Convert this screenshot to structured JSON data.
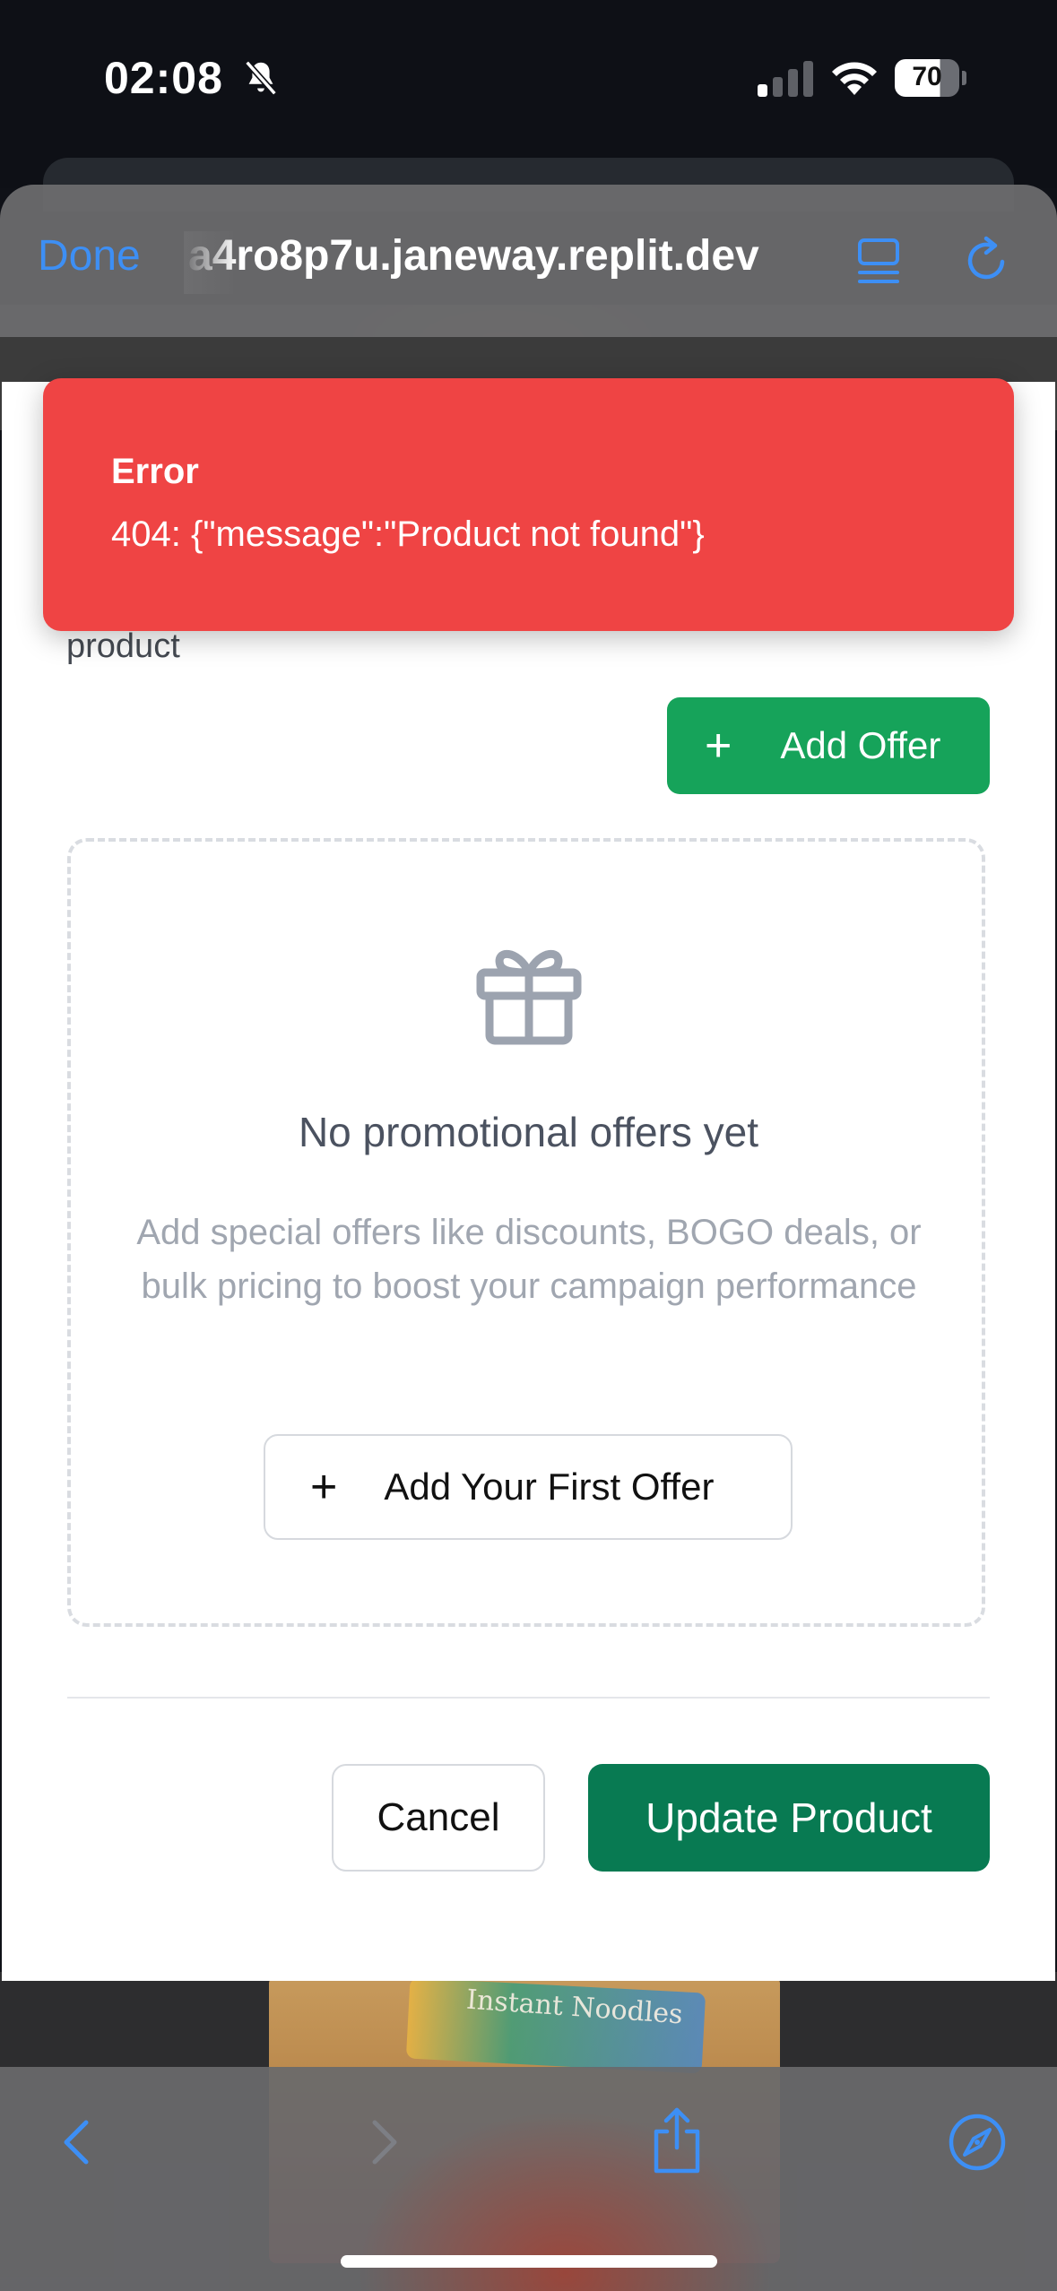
{
  "status_bar": {
    "time": "02:08",
    "battery": "70"
  },
  "browser": {
    "done_label": "Done",
    "url": "a4ro8p7u.janeway.replit.dev"
  },
  "error_toast": {
    "title": "Error",
    "message": "404: {\"message\":\"Product not found\"}"
  },
  "form": {
    "partial_label": "product",
    "add_offer_label": "Add Offer",
    "empty_state": {
      "title": "No promotional offers yet",
      "description": "Add special offers like discounts, BOGO deals, or bulk pricing to boost your campaign performance",
      "add_first_label": "Add Your First Offer"
    },
    "cancel_label": "Cancel",
    "update_label": "Update Product"
  },
  "background": {
    "product_text": "Instant Noodles"
  },
  "colors": {
    "accent_blue": "#3d8ff5",
    "error_red": "#ef4444",
    "offer_green": "#16a35a",
    "update_green": "#087a52"
  },
  "icons": [
    "bell-slash-icon",
    "signal-icon",
    "wifi-icon",
    "battery-icon",
    "reader-icon",
    "reload-icon",
    "gift-icon",
    "plus-icon",
    "back-icon",
    "forward-icon",
    "share-icon",
    "compass-icon"
  ]
}
